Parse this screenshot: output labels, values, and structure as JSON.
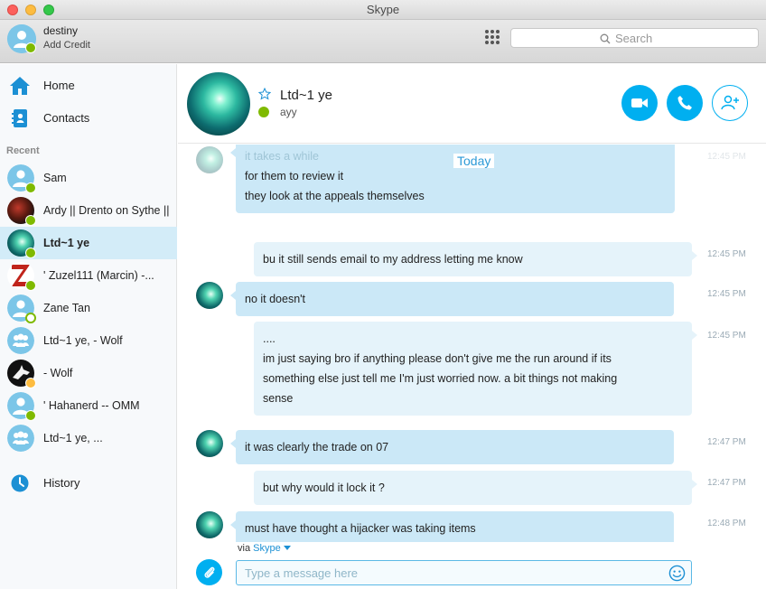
{
  "window": {
    "title": "Skype"
  },
  "profile": {
    "name": "destiny",
    "credit_label": "Add Credit"
  },
  "search": {
    "placeholder": "Search"
  },
  "nav": {
    "home": "Home",
    "contacts": "Contacts",
    "recent": "Recent",
    "history": "History"
  },
  "contacts": [
    {
      "name": "Sam",
      "status": "online",
      "avatar": "default"
    },
    {
      "name": "Ardy || Drento on Sythe ||",
      "status": "online",
      "avatar": "photo-dark"
    },
    {
      "name": "Ltd~1 ye",
      "status": "online",
      "avatar": "photo-teal",
      "active": true
    },
    {
      "name": "' Zuzel111 (Marcin) -...",
      "status": "online",
      "avatar": "photo-red"
    },
    {
      "name": "Zane Tan",
      "status": "offline",
      "avatar": "default"
    },
    {
      "name": "Ltd~1 ye, - Wolf",
      "status": "none",
      "avatar": "group"
    },
    {
      "name": "- Wolf",
      "status": "away",
      "avatar": "photo-wolf"
    },
    {
      "name": "' Hahanerd -- OMM",
      "status": "online",
      "avatar": "default"
    },
    {
      "name": "Ltd~1 ye, ...",
      "status": "none",
      "avatar": "group"
    }
  ],
  "conversation": {
    "name": "Ltd~1 ye",
    "mood": "ayy",
    "day_label": "Today",
    "via_prefix": "via",
    "via_service": "Skype",
    "compose_placeholder": "Type a message here",
    "messages": [
      {
        "dir": "in",
        "lines": [
          "it takes a while",
          "for them to review it",
          "they look at the appeals themselves"
        ],
        "time": "12:45 PM"
      },
      {
        "dir": "out",
        "lines": [
          "bu it still sends email to my address letting me know"
        ],
        "time": "12:45 PM"
      },
      {
        "dir": "in",
        "lines": [
          "no it doesn't"
        ],
        "time": "12:45 PM"
      },
      {
        "dir": "out",
        "lines": [
          "....",
          "im just saying bro if anything please don't give me the run around if its",
          "something else just tell me I'm just worried now. a bit things not making",
          "sense"
        ],
        "time": "12:45 PM"
      },
      {
        "dir": "in",
        "lines": [
          "it was clearly the trade on 07"
        ],
        "time": "12:47 PM"
      },
      {
        "dir": "out",
        "lines": [
          "but why would it lock it ?"
        ],
        "time": "12:47 PM"
      },
      {
        "dir": "in",
        "lines": [
          "must have thought a hijacker was taking items"
        ],
        "time": "12:48 PM"
      }
    ]
  },
  "colors": {
    "accent": "#00aff0",
    "online": "#7fba00",
    "away": "#fdbc40",
    "bubble_in": "#cbe8f7",
    "bubble_out": "#e5f3fa"
  },
  "icons": [
    "home-icon",
    "contacts-icon",
    "history-icon",
    "dialpad-icon",
    "search-icon",
    "video-call-icon",
    "phone-icon",
    "add-contact-icon",
    "attach-icon",
    "emoji-icon",
    "star-icon"
  ]
}
